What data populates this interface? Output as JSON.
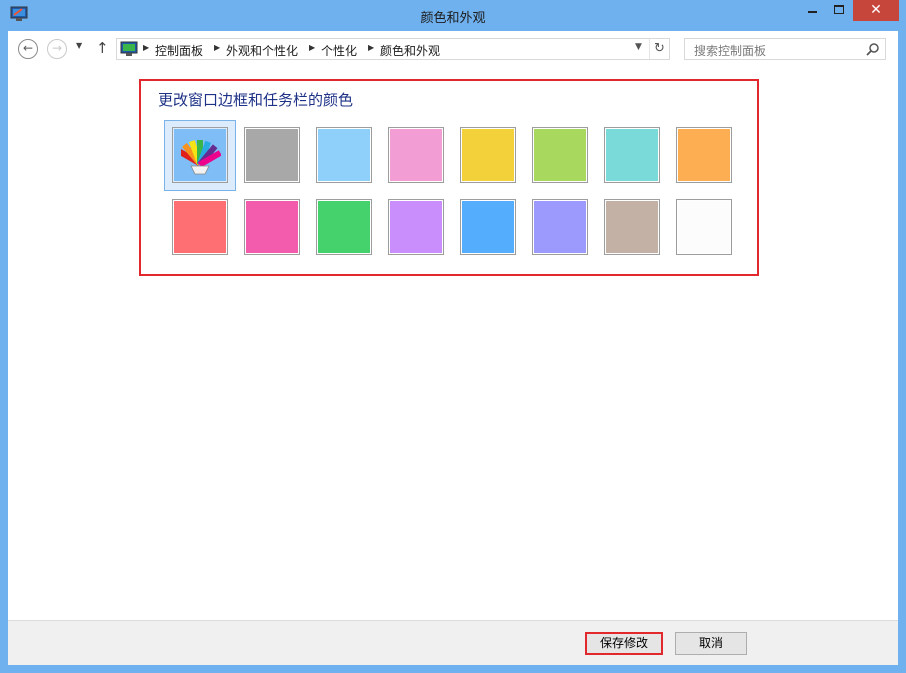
{
  "window": {
    "title": "颜色和外观"
  },
  "nav": {
    "breadcrumbs": [
      "控制面板",
      "外观和个性化",
      "个性化",
      "颜色和外观"
    ],
    "search_placeholder": "搜索控制面板"
  },
  "panel": {
    "heading": "更改窗口边框和任务栏的颜色",
    "selected_index": 0,
    "swatches": [
      {
        "color": "automatic",
        "selected": true
      },
      {
        "color": "#a8a8a8"
      },
      {
        "color": "#8fd0fa"
      },
      {
        "color": "#f39dd5"
      },
      {
        "color": "#f2d13b"
      },
      {
        "color": "#a9d85f"
      },
      {
        "color": "#7ad9d9"
      },
      {
        "color": "#fdad52"
      },
      {
        "color": "#fe6f73"
      },
      {
        "color": "#f35cad"
      },
      {
        "color": "#45d16b"
      },
      {
        "color": "#c98dfc"
      },
      {
        "color": "#55adfd"
      },
      {
        "color": "#9c9bfd"
      },
      {
        "color": "#c4b1a6"
      },
      {
        "color": "#fcfcfc"
      }
    ]
  },
  "buttons": {
    "save": "保存修改",
    "cancel": "取消"
  }
}
